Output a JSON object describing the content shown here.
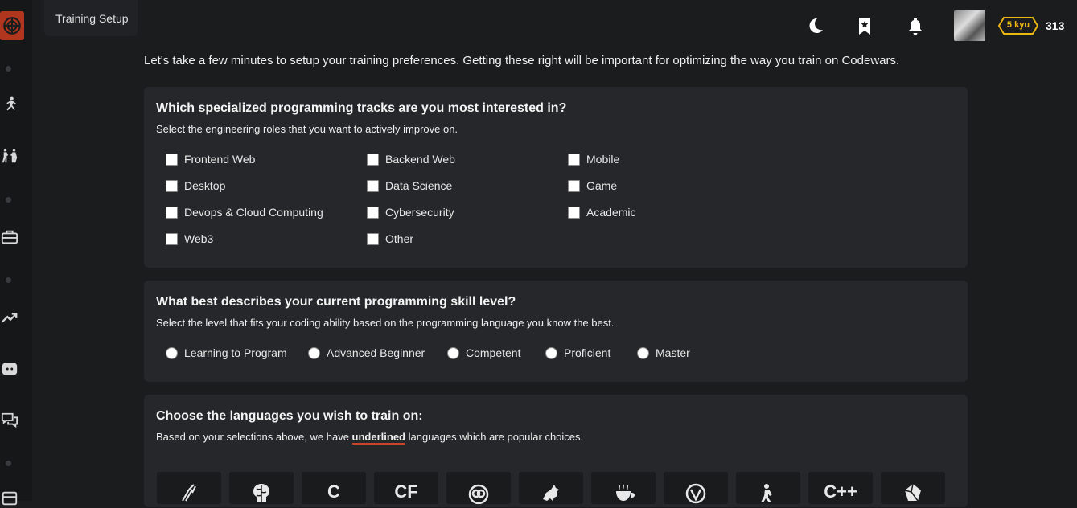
{
  "tab": {
    "title": "Training Setup"
  },
  "header": {
    "rank": "5 kyu",
    "honor": "313"
  },
  "intro": "Let's take a few minutes to setup your training preferences. Getting these right will be important for optimizing the way you train on Codewars.",
  "tracks": {
    "title": "Which specialized programming tracks are you most interested in?",
    "subtitle": "Select the engineering roles that you want to actively improve on.",
    "options": [
      "Frontend Web",
      "Backend Web",
      "Mobile",
      "Desktop",
      "Data Science",
      "Game",
      "Devops & Cloud Computing",
      "Cybersecurity",
      "Academic",
      "Web3",
      "Other"
    ]
  },
  "skill": {
    "title": "What best describes your current programming skill level?",
    "subtitle": "Select the level that fits your coding ability based on the programming language you know the best.",
    "options": [
      "Learning to Program",
      "Advanced Beginner",
      "Competent",
      "Proficient",
      "Master"
    ]
  },
  "languages": {
    "title": "Choose the languages you wish to train on:",
    "subtitle_before": "Based on your selections above, we have ",
    "subtitle_emph": "underlined",
    "subtitle_after": " languages which are popular choices.",
    "icons": [
      "agda-icon",
      "bf-icon",
      "c-icon",
      "cfml-icon",
      "clojure-icon",
      "cobol-icon",
      "coffeescript-icon",
      "commonlisp-icon",
      "coq-icon",
      "cpp-icon",
      "crystal-icon"
    ],
    "glyphs": [
      "",
      "",
      "C",
      "CF",
      "",
      "",
      "",
      "",
      "",
      "C++",
      ""
    ]
  },
  "colors": {
    "accent": "#b1361e",
    "rank": "#ecb613",
    "card": "#26272a",
    "background": "#1b1c1e"
  }
}
